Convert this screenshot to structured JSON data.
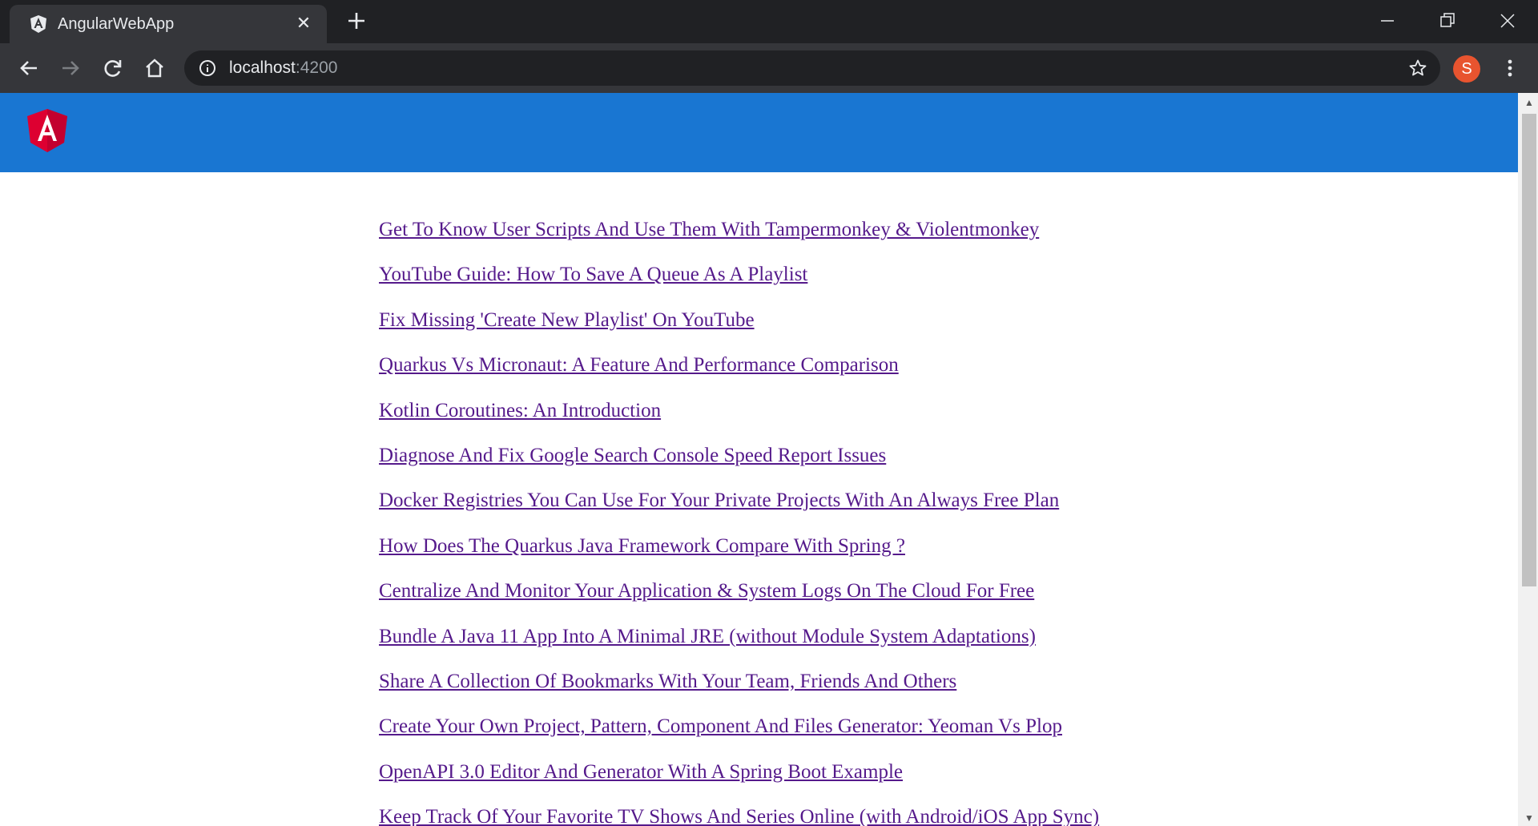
{
  "browser": {
    "tab_title": "AngularWebApp",
    "url_host": "localhost",
    "url_port": ":4200",
    "profile_initial": "S",
    "colors": {
      "frame": "#202124",
      "toolbar": "#35363a",
      "avatar": "#e8542f"
    }
  },
  "app": {
    "header_color": "#1976d2",
    "logo": "angular-logo",
    "posts": [
      "Get To Know User Scripts And Use Them With Tampermonkey & Violentmonkey",
      "YouTube Guide: How To Save A Queue As A Playlist",
      "Fix Missing 'Create New Playlist' On YouTube",
      "Quarkus Vs Micronaut: A Feature And Performance Comparison",
      "Kotlin Coroutines: An Introduction",
      "Diagnose And Fix Google Search Console Speed Report Issues",
      "Docker Registries You Can Use For Your Private Projects With An Always Free Plan",
      "How Does The Quarkus Java Framework Compare With Spring ?",
      "Centralize And Monitor Your Application & System Logs On The Cloud For Free",
      "Bundle A Java 11 App Into A Minimal JRE (without Module System Adaptations)",
      "Share A Collection Of Bookmarks With Your Team, Friends And Others",
      "Create Your Own Project, Pattern, Component And Files Generator: Yeoman Vs Plop",
      "OpenAPI 3.0 Editor And Generator With A Spring Boot Example",
      "Keep Track Of Your Favorite TV Shows And Series Online (with Android/iOS App Sync)"
    ]
  }
}
